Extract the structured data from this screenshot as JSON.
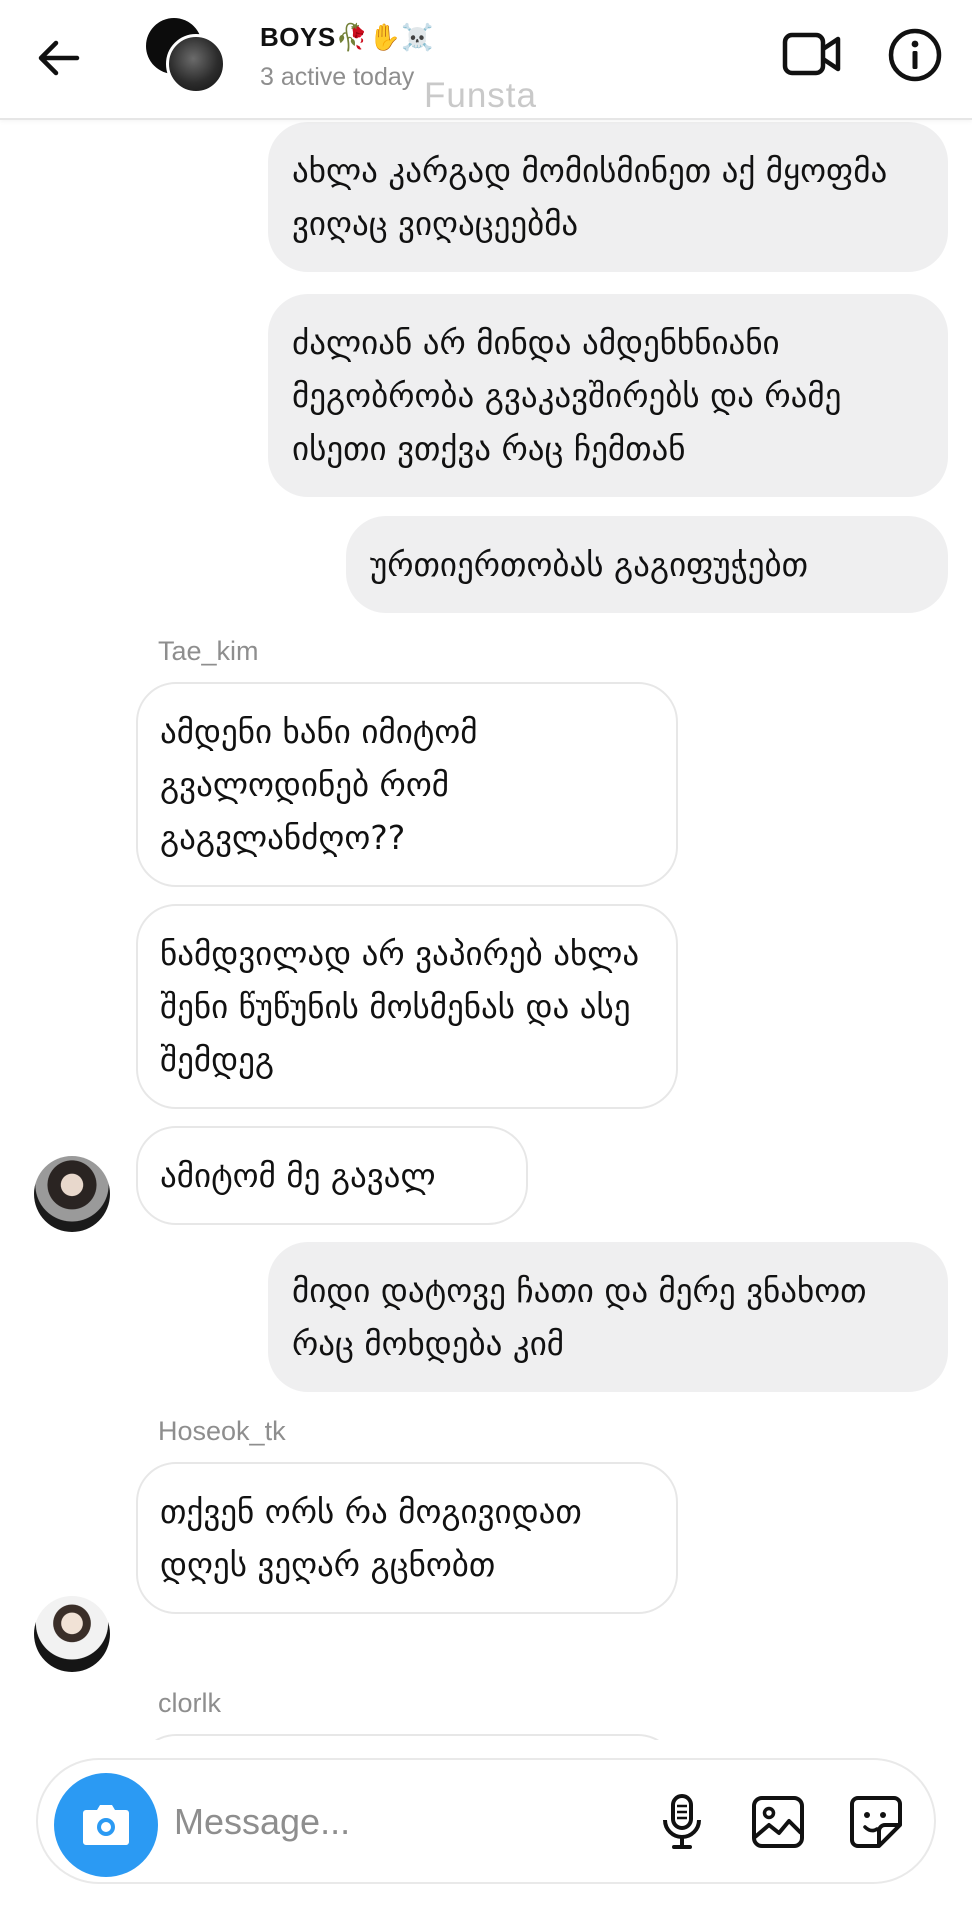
{
  "header": {
    "title": "BOYS🥀✋☠️",
    "subtitle": "3 active today",
    "watermark": "Funsta",
    "icons": [
      "back-arrow-icon",
      "video-camera-icon",
      "info-icon"
    ]
  },
  "messages": [
    {
      "type": "outgoing",
      "text": "ახლა კარგად მომისმინეთ აქ მყოფმა ვიღაც ვიღაცეებმა"
    },
    {
      "type": "outgoing",
      "text": "ძალიან არ მინდა ამდენხნიანი მეგობრობა გვაკავშირებს და რამე ისეთი ვთქვა რაც ჩემთან"
    },
    {
      "type": "outgoing",
      "text": "ურთიერთობას გაგიფუჭებთ"
    },
    {
      "type": "sender",
      "text": "Tae_kim"
    },
    {
      "type": "incoming",
      "text": "ამდენი ხანი იმიტომ გვალოდინებ რომ გაგვლანძღო??"
    },
    {
      "type": "incoming",
      "text": "ნამდვილად არ ვაპირებ ახლა შენი წუწუნის მოსმენას და ასე შემდეგ"
    },
    {
      "type": "incoming",
      "text": "ამიტომ მე გავალ"
    },
    {
      "type": "outgoing",
      "text": "მიდი დატოვე ჩათი და მერე ვნახოთ რაც მოხდება კიმ"
    },
    {
      "type": "sender",
      "text": "Hoseok_tk"
    },
    {
      "type": "incoming",
      "text": "თქვენ ორს რა მოგივიდათ დღეს ვეღარ გცნობთ"
    },
    {
      "type": "sender",
      "text": "clorlk"
    }
  ],
  "composer": {
    "placeholder": "Message...",
    "icons": [
      "camera-icon",
      "microphone-icon",
      "photo-icon",
      "sticker-icon"
    ],
    "accent_color": "#2b9af3"
  },
  "colors": {
    "outgoing_bubble": "#efeff0",
    "incoming_border": "#e7e7e7",
    "muted_text": "#8e8e8e"
  }
}
